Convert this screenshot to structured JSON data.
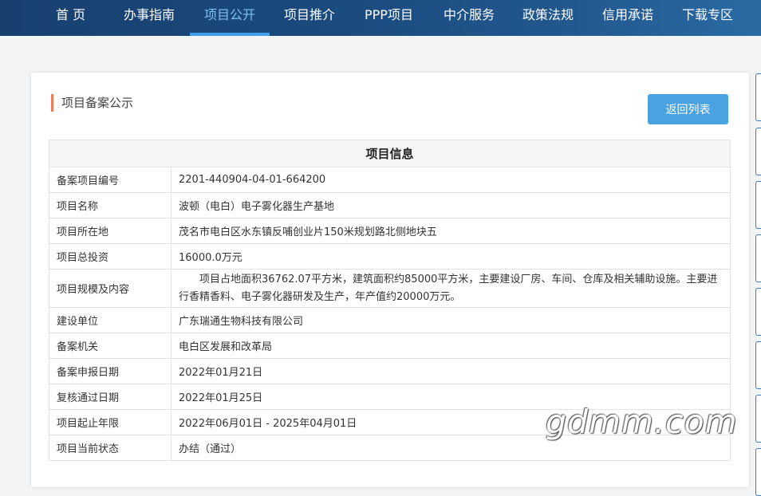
{
  "nav": {
    "items": [
      "首 页",
      "办事指南",
      "项目公开",
      "项目推介",
      "PPP项目",
      "中介服务",
      "政策法规",
      "信用承诺",
      "下载专区"
    ],
    "active_index": 2
  },
  "page": {
    "section_title": "项目备案公示",
    "back_button": "返回列表"
  },
  "table": {
    "header": "项目信息",
    "rows": [
      {
        "label": "备案项目编号",
        "value": "2201-440904-04-01-664200"
      },
      {
        "label": "项目名称",
        "value": "波顿（电白）电子雾化器生产基地"
      },
      {
        "label": "项目所在地",
        "value": "茂名市电白区水东镇反哺创业片150米规划路北侧地块五"
      },
      {
        "label": "项目总投资",
        "value": "16000.0万元"
      },
      {
        "label": "项目规模及内容",
        "value": "项目占地面积36762.07平方米，建筑面积约85000平方米，主要建设厂房、车间、仓库及相关辅助设施。主要进行香精香料、电子雾化器研发及生产，年产值约20000万元。"
      },
      {
        "label": "建设单位",
        "value": "广东瑞通生物科技有限公司"
      },
      {
        "label": "备案机关",
        "value": "电白区发展和改革局"
      },
      {
        "label": "备案申报日期",
        "value": "2022年01月21日"
      },
      {
        "label": "复核通过日期",
        "value": "2022年01月25日"
      },
      {
        "label": "项目起止年限",
        "value": "2022年06月01日 - 2025年04月01日"
      },
      {
        "label": "项目当前状态",
        "value": "办结（通过）"
      }
    ]
  },
  "watermark": "gdmm.com",
  "colors": {
    "nav_bg": "#1b4a7e",
    "nav_active": "#7fc0f2",
    "accent_bar": "#ee7e58",
    "button": "#4aa2e1"
  }
}
